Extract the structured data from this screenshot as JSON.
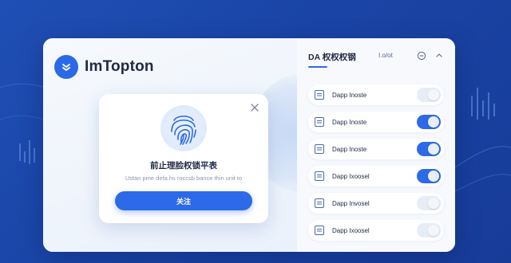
{
  "brand": {
    "name": "ImTopton",
    "logo_icon": "shield-check-icon"
  },
  "modal": {
    "title": "前止理脸权锁平表",
    "description": "Ustan pme defa hs roccsb bance thin unit to",
    "primary_label": "关注",
    "close_icon": "close-icon",
    "fingerprint_icon": "fingerprint-icon"
  },
  "panel": {
    "title": "DA 权权权钢",
    "subtitle": "I.o/ot",
    "header_icons": [
      "info-circle-icon",
      "expand-icon"
    ],
    "rows": [
      {
        "label": "Dapp Inoste",
        "icon": "checklist-icon",
        "enabled": false
      },
      {
        "label": "Dapp Inoste",
        "icon": "document-icon",
        "enabled": true
      },
      {
        "label": "Dapp Inoste",
        "icon": "window-icon",
        "enabled": true
      },
      {
        "label": "Dapp Ixoosel",
        "icon": "card-icon",
        "enabled": true
      },
      {
        "label": "Dapp Invosel",
        "icon": "window-icon",
        "enabled": false
      },
      {
        "label": "Dapp Ixoosel",
        "icon": "file-icon",
        "enabled": false
      }
    ]
  },
  "colors": {
    "accent": "#2d6ae8",
    "background": "#1f4fb4",
    "text": "#1e2a46"
  }
}
